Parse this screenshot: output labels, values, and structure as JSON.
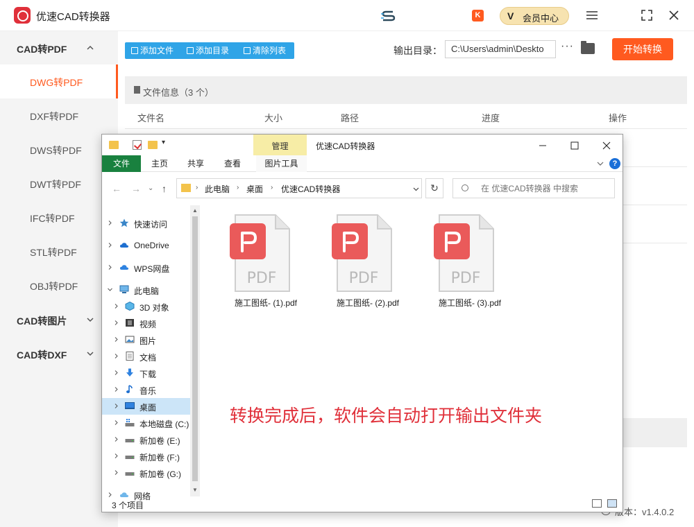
{
  "app": {
    "title": "优速CAD转换器",
    "vip_badge": "V",
    "vip_label": "会员中心",
    "k_badge": "K"
  },
  "sidebar": {
    "groups": [
      {
        "label": "CAD转PDF",
        "expanded": true
      },
      {
        "label": "CAD转图片",
        "expanded": false
      },
      {
        "label": "CAD转DXF",
        "expanded": false
      }
    ],
    "items": [
      {
        "label": "DWG转PDF",
        "active": true
      },
      {
        "label": "DXF转PDF"
      },
      {
        "label": "DWS转PDF"
      },
      {
        "label": "DWT转PDF"
      },
      {
        "label": "IFC转PDF"
      },
      {
        "label": "STL转PDF"
      },
      {
        "label": "OBJ转PDF"
      }
    ]
  },
  "toolbar": {
    "add_file": "添加文件",
    "add_dir": "添加目录",
    "clear_list": "清除列表",
    "output_label": "输出目录：",
    "output_path": "C:\\Users\\admin\\Deskto",
    "more": "···",
    "start": "开始转换"
  },
  "file_panel": {
    "info_label": "文件信息（3 个）",
    "columns": [
      "文件名",
      "大小",
      "路径",
      "进度",
      "操作"
    ]
  },
  "footer": {
    "version": "版本：v1.4.0.2"
  },
  "explorer": {
    "manage_tab": "管理",
    "window_title": "优速CAD转换器",
    "ribbon_tabs": [
      "文件",
      "主页",
      "共享",
      "查看",
      "图片工具"
    ],
    "help": "?",
    "breadcrumb": [
      "此电脑",
      "桌面",
      "优速CAD转换器"
    ],
    "search_placeholder": "在 优速CAD转换器 中搜索",
    "nav_items": [
      {
        "label": "快速访问",
        "icon": "star-icon"
      },
      {
        "label": "OneDrive",
        "icon": "cloud-icon"
      },
      {
        "label": "WPS网盘",
        "icon": "cloud-icon"
      },
      {
        "label": "此电脑",
        "icon": "computer-icon"
      },
      {
        "label": "3D 对象",
        "icon": "cube-icon"
      },
      {
        "label": "视频",
        "icon": "film-icon"
      },
      {
        "label": "图片",
        "icon": "picture-icon"
      },
      {
        "label": "文档",
        "icon": "document-icon"
      },
      {
        "label": "下载",
        "icon": "download-icon"
      },
      {
        "label": "音乐",
        "icon": "music-icon"
      },
      {
        "label": "桌面",
        "icon": "desktop-icon",
        "selected": true
      },
      {
        "label": "本地磁盘 (C:)",
        "icon": "drive-icon"
      },
      {
        "label": "新加卷 (E:)",
        "icon": "drive-icon"
      },
      {
        "label": "新加卷 (F:)",
        "icon": "drive-icon"
      },
      {
        "label": "新加卷 (G:)",
        "icon": "drive-icon"
      },
      {
        "label": "网络",
        "icon": "network-icon"
      }
    ],
    "files": [
      {
        "name": "施工图纸- (1).pdf",
        "type": "PDF"
      },
      {
        "name": "施工图纸- (2).pdf",
        "type": "PDF"
      },
      {
        "name": "施工图纸- (3).pdf",
        "type": "PDF"
      }
    ],
    "annotation": "转换完成后，软件会自动打开输出文件夹",
    "status": "3 个项目"
  },
  "colors": {
    "accent_orange": "#ff5a1f",
    "toolbar_blue": "#2fa4e7",
    "pdf_red": "#ea5a5a",
    "annotation_red": "#e0303a"
  }
}
